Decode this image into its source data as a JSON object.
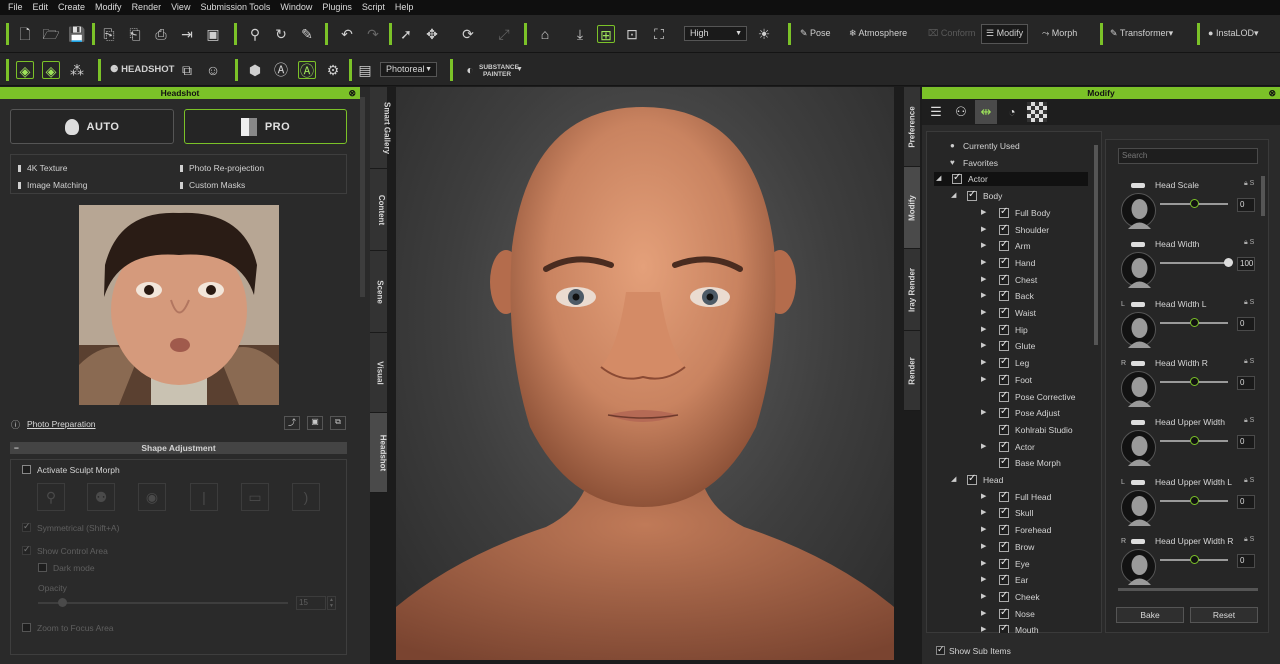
{
  "menu": [
    "File",
    "Edit",
    "Create",
    "Modify",
    "Render",
    "View",
    "Submission Tools",
    "Window",
    "Plugins",
    "Script",
    "Help"
  ],
  "toolbar": {
    "quality": "High",
    "pose": "Pose",
    "atmosphere": "Atmosphere",
    "conform": "Conform",
    "modify": "Modify",
    "morph": "Morph",
    "transformer": "Transformer",
    "instalod": "InstaLOD",
    "headshot": "HEADSHOT",
    "render_mode": "Photoreal",
    "substance_top": "SUBSTANCE",
    "substance_bottom": "PAINTER"
  },
  "headshot": {
    "title": "Headshot",
    "auto": "AUTO",
    "pro": "PRO",
    "features": [
      "4K Texture",
      "Photo Re-projection",
      "Image Matching",
      "Custom Masks"
    ],
    "photo_prep": "Photo Preparation",
    "shape_adjustment": "Shape Adjustment",
    "activate_sculpt": "Activate Sculpt Morph",
    "symmetrical": "Symmetrical (Shift+A)",
    "show_control": "Show Control Area",
    "dark_mode": "Dark mode",
    "opacity": "Opacity",
    "opacity_value": "15",
    "zoom_focus": "Zoom to Focus Area"
  },
  "left_tabs": [
    "Smart Gallery",
    "Content",
    "Scene",
    "Visual",
    "Headshot"
  ],
  "right_tabs": [
    "Preference",
    "Modify",
    "Iray Render",
    "Render"
  ],
  "modify": {
    "title": "Modify",
    "search_placeholder": "Search",
    "show_sub": "Show Sub Items",
    "bake": "Bake",
    "reset": "Reset"
  },
  "tree": [
    {
      "label": "Currently Used",
      "lvl": 0,
      "kind": "dot"
    },
    {
      "label": "Favorites",
      "lvl": 0,
      "kind": "heart"
    },
    {
      "label": "Actor",
      "lvl": 0,
      "kind": "open",
      "sel": true
    },
    {
      "label": "Body",
      "lvl": 1,
      "kind": "open"
    },
    {
      "label": "Full Body",
      "lvl": 2,
      "kind": "closed"
    },
    {
      "label": "Shoulder",
      "lvl": 2,
      "kind": "closed"
    },
    {
      "label": "Arm",
      "lvl": 2,
      "kind": "closed"
    },
    {
      "label": "Hand",
      "lvl": 2,
      "kind": "closed"
    },
    {
      "label": "Chest",
      "lvl": 2,
      "kind": "closed"
    },
    {
      "label": "Back",
      "lvl": 2,
      "kind": "closed"
    },
    {
      "label": "Waist",
      "lvl": 2,
      "kind": "closed"
    },
    {
      "label": "Hip",
      "lvl": 2,
      "kind": "closed"
    },
    {
      "label": "Glute",
      "lvl": 2,
      "kind": "closed"
    },
    {
      "label": "Leg",
      "lvl": 2,
      "kind": "closed"
    },
    {
      "label": "Foot",
      "lvl": 2,
      "kind": "closed"
    },
    {
      "label": "Pose Corrective",
      "lvl": 2,
      "kind": "none"
    },
    {
      "label": "Pose Adjust",
      "lvl": 2,
      "kind": "closed"
    },
    {
      "label": "Kohlrabi Studio",
      "lvl": 2,
      "kind": "none"
    },
    {
      "label": "Actor",
      "lvl": 2,
      "kind": "closed"
    },
    {
      "label": "Base Morph",
      "lvl": 2,
      "kind": "none"
    },
    {
      "label": "Head",
      "lvl": 1,
      "kind": "open"
    },
    {
      "label": "Full Head",
      "lvl": 2,
      "kind": "closed"
    },
    {
      "label": "Skull",
      "lvl": 2,
      "kind": "closed"
    },
    {
      "label": "Forehead",
      "lvl": 2,
      "kind": "closed"
    },
    {
      "label": "Brow",
      "lvl": 2,
      "kind": "closed"
    },
    {
      "label": "Eye",
      "lvl": 2,
      "kind": "closed"
    },
    {
      "label": "Ear",
      "lvl": 2,
      "kind": "closed"
    },
    {
      "label": "Cheek",
      "lvl": 2,
      "kind": "closed"
    },
    {
      "label": "Nose",
      "lvl": 2,
      "kind": "closed"
    },
    {
      "label": "Mouth",
      "lvl": 2,
      "kind": "closed"
    }
  ],
  "sliders": [
    {
      "name": "Head Scale",
      "value": "0",
      "level": 0.5,
      "side": ""
    },
    {
      "name": "Head Width",
      "value": "100",
      "level": 1.0,
      "side": ""
    },
    {
      "name": "Head Width L",
      "value": "0",
      "level": 0.5,
      "side": "L"
    },
    {
      "name": "Head Width R",
      "value": "0",
      "level": 0.5,
      "side": "R"
    },
    {
      "name": "Head Upper Width",
      "value": "0",
      "level": 0.5,
      "side": ""
    },
    {
      "name": "Head Upper Width L",
      "value": "0",
      "level": 0.5,
      "side": "L"
    },
    {
      "name": "Head Upper Width R",
      "value": "0",
      "level": 0.5,
      "side": "R"
    }
  ],
  "colors": {
    "accent": "#7bc228",
    "knob_green": "#7bc228"
  }
}
